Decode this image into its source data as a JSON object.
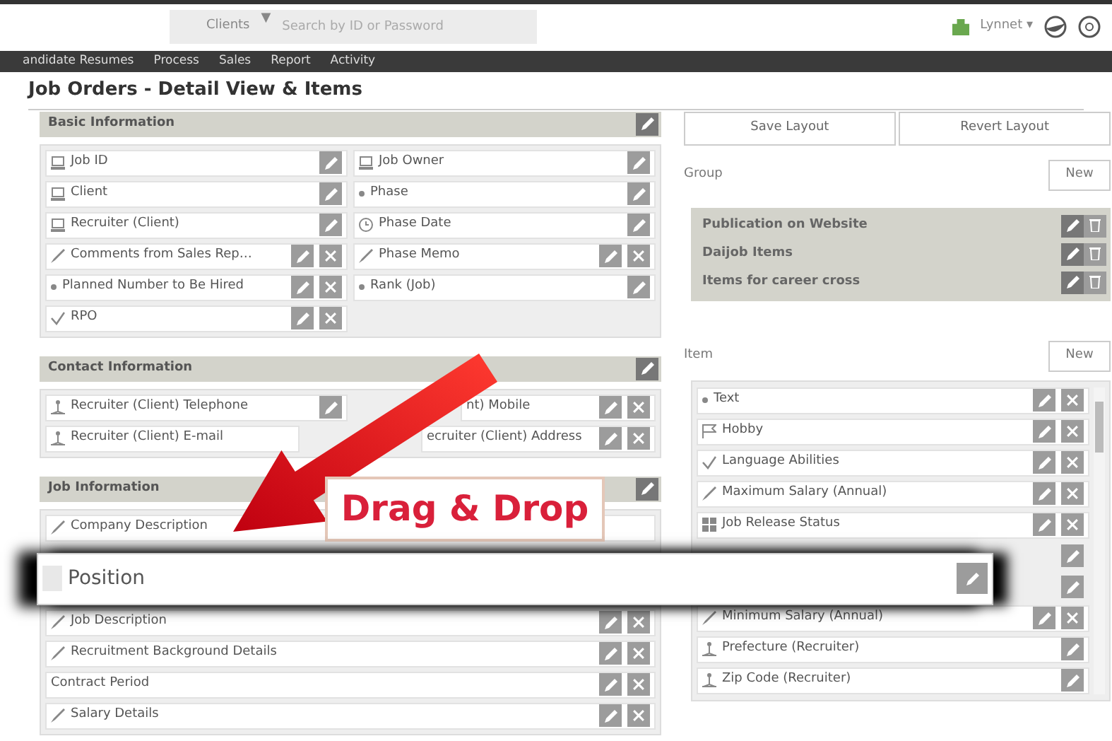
{
  "top_bar": {
    "dropdown": "Clients",
    "dropdown_caret": "▼",
    "search_placeholder": "Search by ID or Password",
    "user": "Lynnet ▾"
  },
  "nav": [
    "andidate Resumes",
    "Process",
    "Sales",
    "Report",
    "Activity"
  ],
  "page_title": "Job Orders - Detail View & Items",
  "sections": [
    {
      "title": "Basic Information",
      "columns": [
        [
          {
            "label": "Job ID",
            "kind": "text",
            "edit": true,
            "delete": false
          },
          {
            "label": "Client",
            "kind": "text",
            "edit": true,
            "delete": false
          },
          {
            "label": "Recruiter (Client)",
            "kind": "text",
            "edit": true,
            "delete": false
          },
          {
            "label": "Comments from Sales Rep…",
            "kind": "memo",
            "edit": true,
            "delete": true
          },
          {
            "label": "Planned Number to Be Hired",
            "kind": "select",
            "edit": true,
            "delete": true
          },
          {
            "label": "RPO",
            "kind": "check",
            "edit": true,
            "delete": true
          }
        ],
        [
          {
            "label": "Job Owner",
            "kind": "text",
            "edit": true,
            "delete": false
          },
          {
            "label": "Phase",
            "kind": "select",
            "edit": true,
            "delete": false
          },
          {
            "label": "Phase Date",
            "kind": "date",
            "edit": true,
            "delete": false
          },
          {
            "label": "Phase Memo",
            "kind": "memo",
            "edit": true,
            "delete": true
          },
          {
            "label": "Rank (Job)",
            "kind": "select",
            "edit": true,
            "delete": false
          }
        ]
      ]
    },
    {
      "title": "Contact Information",
      "columns": [
        [
          {
            "label": "Recruiter (Client) Telephone",
            "kind": "person",
            "edit": true,
            "delete": false
          },
          {
            "label": "Recruiter (Client) E-mail",
            "kind": "person",
            "edit": false,
            "delete": false
          }
        ],
        [
          {
            "label": "nt) Mobile",
            "kind": "none",
            "edit": true,
            "delete": true
          },
          {
            "label": "ecruiter (Client) Address",
            "kind": "none",
            "edit": true,
            "delete": true
          }
        ]
      ]
    },
    {
      "title": "Job Information",
      "columns": [
        [
          {
            "label": "Company Description",
            "kind": "memo",
            "edit": false,
            "delete": false
          },
          {
            "label": "Position",
            "kind": "dragging",
            "edit": true,
            "delete": false
          },
          {
            "label": "Job Description",
            "kind": "memo",
            "edit": true,
            "delete": true
          },
          {
            "label": "Recruitment Background Details",
            "kind": "memo",
            "edit": true,
            "delete": true
          },
          {
            "label": "Contract Period",
            "kind": "none",
            "edit": true,
            "delete": true
          },
          {
            "label": "Salary Details",
            "kind": "memo",
            "edit": true,
            "delete": true
          }
        ]
      ]
    }
  ],
  "drag_label": "Drag & Drop",
  "layout_buttons": [
    "Save Layout",
    "Revert Layout"
  ],
  "group_panel": {
    "label": "Group",
    "new_button": "New",
    "groups": [
      "Publication on Website",
      "Daijob Items",
      "Items for career cross"
    ]
  },
  "item_panel": {
    "label": "Item",
    "new_button": "New",
    "items": [
      {
        "label": "Text",
        "kind": "select",
        "edit": true,
        "delete": true
      },
      {
        "label": "Hobby",
        "kind": "flag",
        "edit": true,
        "delete": true
      },
      {
        "label": "Language Abilities",
        "kind": "check",
        "edit": true,
        "delete": true
      },
      {
        "label": "Maximum Salary (Annual)",
        "kind": "memo",
        "edit": true,
        "delete": true
      },
      {
        "label": "Job Release Status",
        "kind": "grid",
        "edit": true,
        "delete": true
      },
      {
        "kind": "covered",
        "edit": true,
        "delete": false
      },
      {
        "kind": "covered",
        "edit": true,
        "delete": false
      },
      {
        "label": "Minimum Salary (Annual)",
        "kind": "memo",
        "edit": true,
        "delete": true
      },
      {
        "label": "Prefecture (Recruiter)",
        "kind": "person",
        "edit": true,
        "delete": false
      },
      {
        "label": "Zip Code (Recruiter)",
        "kind": "person",
        "edit": true,
        "delete": false
      }
    ]
  }
}
